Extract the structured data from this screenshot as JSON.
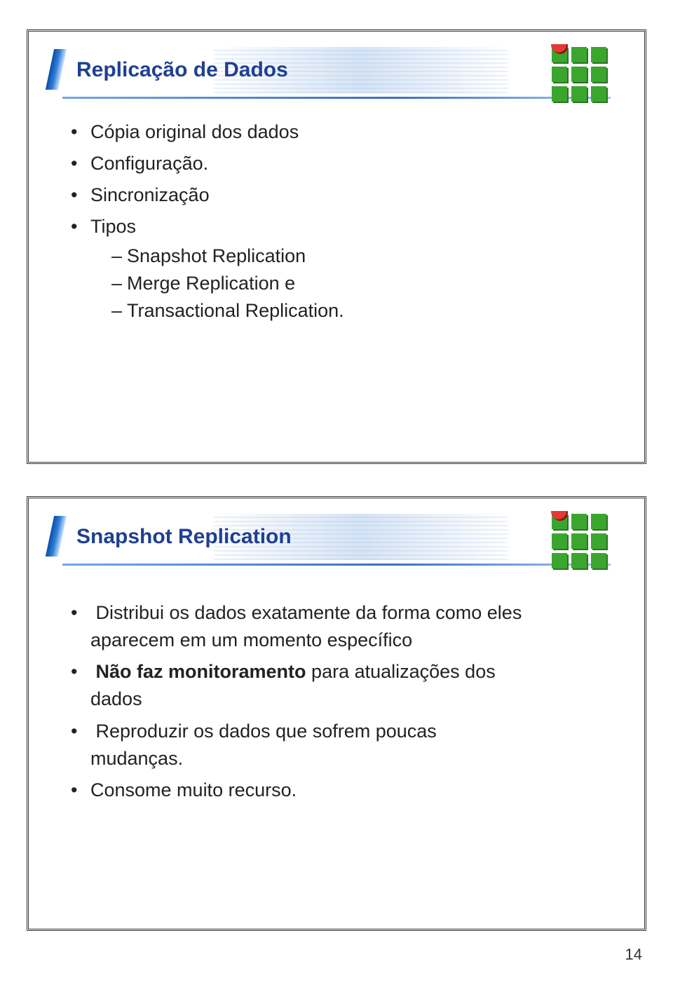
{
  "slide1": {
    "title": "Replicação de Dados",
    "bullets": {
      "b1": "Cópia original dos dados",
      "b2": "Configuração.",
      "b3": "Sincronização",
      "b4": "Tipos",
      "sub": {
        "s1": "Snapshot Replication",
        "s2": "Merge Replication e",
        "s3": "Transactional Replication."
      }
    }
  },
  "slide2": {
    "title": "Snapshot Replication",
    "bullets": {
      "b1a": "Distribui os dados exatamente da forma como eles ",
      "b1b": "aparecem em um momento específico",
      "b2_bold": "Não faz monitoramento",
      "b2_rest": " para atualizações dos ",
      "b2c": "dados",
      "b3a": "Reproduzir os dados que sofrem poucas ",
      "b3b": "mudanças.",
      "b4": "Consome muito recurso."
    }
  },
  "page_number": "14"
}
